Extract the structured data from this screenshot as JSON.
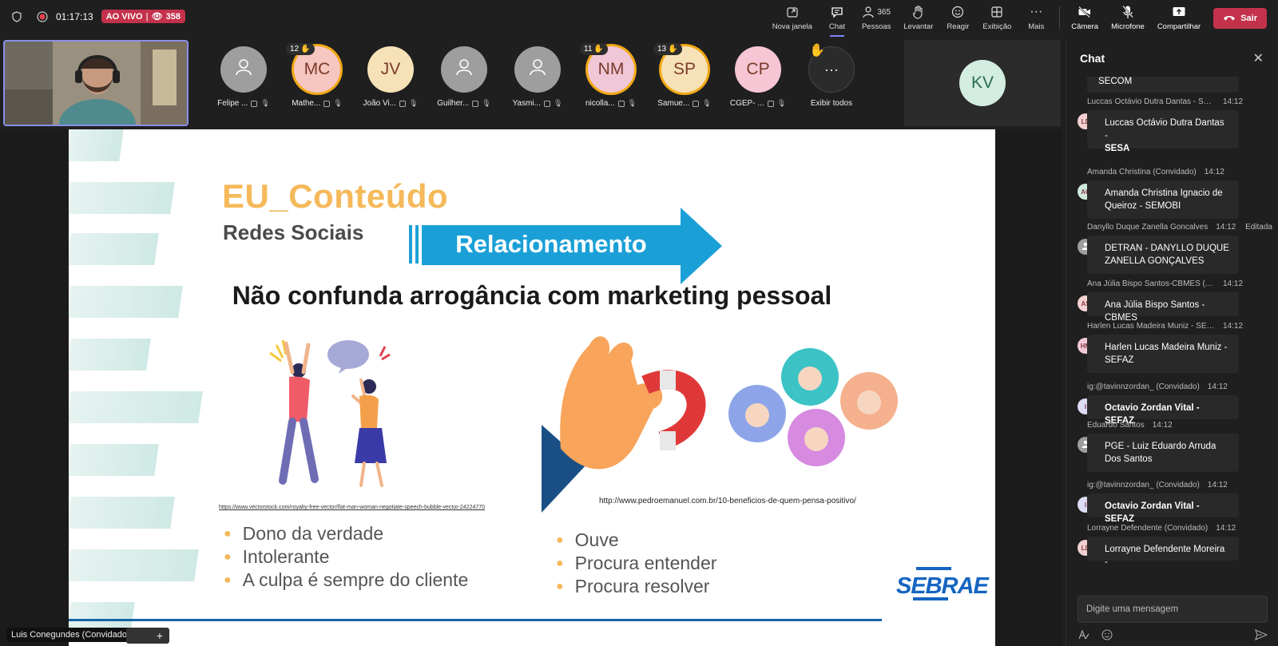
{
  "topbar": {
    "timer": "01:17:13",
    "live_label": "AO VIVO",
    "viewers": "358",
    "actions": {
      "new_window": "Nova janela",
      "chat": "Chat",
      "people_count": "365",
      "people": "Pessoas",
      "raise": "Levantar",
      "react": "Reagir",
      "view": "Exibição",
      "more": "Mais",
      "camera": "Câmera",
      "mic": "Microfone",
      "share": "Compartilhar",
      "leave": "Sair"
    }
  },
  "participants": [
    {
      "initials": "",
      "name": "Felipe ...",
      "color": "#9e9e9e",
      "hand": null
    },
    {
      "initials": "MC",
      "name": "Mathe...",
      "color": "#f6c6c0",
      "hand": "12"
    },
    {
      "initials": "JV",
      "name": "João Vi...",
      "color": "#f7e2b8",
      "hand": null
    },
    {
      "initials": "",
      "name": "Guilher...",
      "color": "#9e9e9e",
      "hand": null
    },
    {
      "initials": "",
      "name": "Yasmi...",
      "color": "#9e9e9e",
      "hand": null
    },
    {
      "initials": "NM",
      "name": "nicolla...",
      "color": "#f0c7d6",
      "hand": "11"
    },
    {
      "initials": "SP",
      "name": "Samue...",
      "color": "#f7e2b8",
      "hand": "13"
    },
    {
      "initials": "CP",
      "name": "CGEP- ...",
      "color": "#f6c6d4",
      "hand": null
    }
  ],
  "show_all": "Exibir todos",
  "spotlight_tile": {
    "initials": "KV"
  },
  "slide": {
    "title": "EU_Conteúdo",
    "subtitle": "Redes Sociais",
    "arrow_label": "Relacionamento",
    "heading": "Não confunda arrogância com marketing pessoal",
    "credit_left": "https://www.vectorstock.com/royalty-free-vector/flat-man-woman-negotiate-speech-bubble-vector-24224770",
    "credit_right": "http://www.pedroemanuel.com.br/10-beneficios-de-quem-pensa-positivo/",
    "bullets_left": [
      "Dono da verdade",
      "Intolerante",
      "A culpa é sempre do cliente"
    ],
    "bullets_right": [
      "Ouve",
      "Procura entender",
      "Procura resolver"
    ],
    "logo": "SEBRAE"
  },
  "presenter": "Luis Conegundes (Convidado)",
  "chat": {
    "title": "Chat",
    "partial_top": "SECOM",
    "messages": [
      {
        "name": "Luccas Octávio Dutra Dantas - SESA/GTI ...",
        "time": "14:12",
        "initials": "LD",
        "avatar_color": "#f3d0d0",
        "text_line1": "Luccas Octávio Dutra Dantas -",
        "text_line2": "SESA",
        "edited": ""
      },
      {
        "name": "Amanda Christina (Convidado)",
        "time": "14:12",
        "initials": "AC",
        "avatar_color": "#cfe9dd",
        "text_line1": "Amanda Christina Ignacio de",
        "text_line2": "Queiroz - SEMOBI",
        "edited": ""
      },
      {
        "name": "Danyllo Duque Zanella Goncalves",
        "time": "14:12",
        "initials": "",
        "avatar_color": "#9e9e9e",
        "text_line1": "DETRAN - DANYLLO DUQUE",
        "text_line2": "ZANELLA GONÇALVES",
        "edited": "Editada"
      },
      {
        "name": "Ana Júlia Bispo Santos-CBMES (Convidad...",
        "time": "14:12",
        "initials": "AS",
        "avatar_color": "#f6d3d3",
        "text_line1": "Ana Júlia Bispo Santos - CBMES",
        "text_line2": "",
        "edited": ""
      },
      {
        "name": "Harlen Lucas Madeira Muniz - SEFAZ (Co...",
        "time": "14:12",
        "initials": "HM",
        "avatar_color": "#f3cbd6",
        "text_line1": "Harlen Lucas Madeira Muniz -",
        "text_line2": "SEFAZ",
        "edited": ""
      },
      {
        "name": "ig:@tavinnzordan_ (Convidado)",
        "time": "14:12",
        "initials": "I",
        "avatar_color": "#dcdcf3",
        "text_line1": "Octavio Zordan Vital - SEFAZ",
        "text_line2": "",
        "edited": ""
      },
      {
        "name": "Eduardo Santos",
        "time": "14:12",
        "initials": "",
        "avatar_color": "#9e9e9e",
        "text_line1": "PGE - Luiz Eduardo Arruda",
        "text_line2": "Dos Santos",
        "edited": ""
      },
      {
        "name": "ig:@tavinnzordan_ (Convidado)",
        "time": "14:12",
        "initials": "I",
        "avatar_color": "#dcdcf3",
        "text_line1": "Octavio Zordan Vital - SEFAZ",
        "text_line2": "",
        "edited": ""
      },
      {
        "name": "Lorrayne Defendente (Convidado)",
        "time": "14:12",
        "initials": "LD",
        "avatar_color": "#f3d0d0",
        "text_line1": "Lorrayne Defendente Moreira -",
        "text_line2": "",
        "edited": ""
      }
    ],
    "input_placeholder": "Digite uma mensagem"
  }
}
